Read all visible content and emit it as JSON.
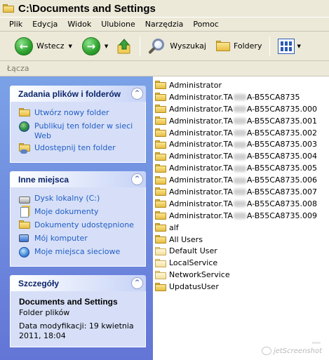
{
  "window": {
    "title": "C:\\Documents and Settings",
    "title_icon": "folder-icon"
  },
  "menu": [
    "Plik",
    "Edycja",
    "Widok",
    "Ulubione",
    "Narzędzia",
    "Pomoc"
  ],
  "toolbar": {
    "back_label": "Wstecz",
    "search_label": "Wyszukaj",
    "folders_label": "Foldery",
    "icons": [
      "back-arrow-icon",
      "forward-arrow-icon",
      "folder-up-icon",
      "search-icon",
      "folders-icon",
      "views-icon"
    ]
  },
  "links_bar": {
    "label": "Łącza"
  },
  "tasks_panel": {
    "title": "Zadania plików i folderów",
    "items": [
      {
        "label": "Utwórz nowy folder",
        "icon": "new-folder-icon"
      },
      {
        "label": "Publikuj ten folder w sieci Web",
        "icon": "publish-web-icon"
      },
      {
        "label": "Udostępnij ten folder",
        "icon": "share-folder-icon"
      }
    ]
  },
  "places_panel": {
    "title": "Inne miejsca",
    "items": [
      {
        "label": "Dysk lokalny (C:)",
        "icon": "local-disk-icon"
      },
      {
        "label": "Moje dokumenty",
        "icon": "my-documents-icon"
      },
      {
        "label": "Dokumenty udostępnione",
        "icon": "shared-documents-icon"
      },
      {
        "label": "Mój komputer",
        "icon": "my-computer-icon"
      },
      {
        "label": "Moje miejsca sieciowe",
        "icon": "network-places-icon"
      }
    ]
  },
  "details_panel": {
    "title": "Szczegóły",
    "name": "Documents and Settings",
    "type": "Folder plików",
    "modified": "Data modyfikacji: 19 kwietnia 2011, 18:04"
  },
  "files": [
    {
      "name": "Administrator"
    },
    {
      "name_pre": "Administrator.TA",
      "name_post": "A-B55CA8735"
    },
    {
      "name_pre": "Administrator.TA",
      "name_post": "A-B55CA8735.000"
    },
    {
      "name_pre": "Administrator.TA",
      "name_post": "A-B55CA8735.001"
    },
    {
      "name_pre": "Administrator.TA",
      "name_post": "A-B55CA8735.002"
    },
    {
      "name_pre": "Administrator.TA",
      "name_post": "A-B55CA8735.003"
    },
    {
      "name_pre": "Administrator.TA",
      "name_post": "A-B55CA8735.004"
    },
    {
      "name_pre": "Administrator.TA",
      "name_post": "A-B55CA8735.005"
    },
    {
      "name_pre": "Administrator.TA",
      "name_post": "A-B55CA8735.006"
    },
    {
      "name_pre": "Administrator.TA",
      "name_post": "A-B55CA8735.007"
    },
    {
      "name_pre": "Administrator.TA",
      "name_post": "A-B55CA8735.008"
    },
    {
      "name_pre": "Administrator.TA",
      "name_post": "A-B55CA8735.009"
    },
    {
      "name": "alf"
    },
    {
      "name": "All Users"
    },
    {
      "name": "Default User",
      "hidden": true
    },
    {
      "name": "LocalService",
      "hidden": true
    },
    {
      "name": "NetworkService",
      "hidden": true
    },
    {
      "name": "UpdatusUser"
    }
  ],
  "watermark": {
    "text": "jetScreenshot",
    "small": "www"
  }
}
